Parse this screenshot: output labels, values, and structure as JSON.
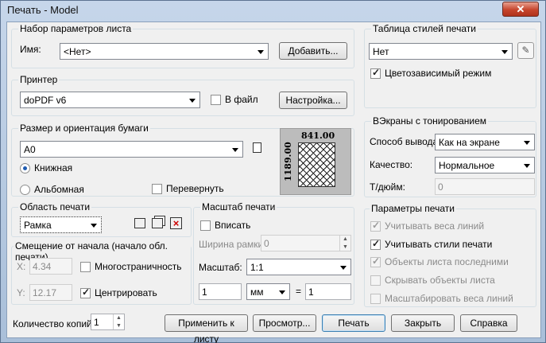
{
  "window": {
    "title": "Печать - Model",
    "close": "✕"
  },
  "page_setup": {
    "legend": "Набор параметров листа",
    "name_label": "Имя:",
    "name_value": "<Нет>",
    "add_button": "Добавить..."
  },
  "printer": {
    "legend": "Принтер",
    "name_value": "doPDF v6",
    "to_file_label": "В файл",
    "to_file_checked": false,
    "props_button": "Настройка..."
  },
  "paper": {
    "legend": "Размер и ориентация бумаги",
    "size_value": "A0",
    "portrait_label": "Книжная",
    "landscape_label": "Альбомная",
    "orientation": "portrait",
    "upside_down_label": "Перевернуть",
    "upside_down_checked": false,
    "preview_width": "841.00",
    "preview_height": "1189.00"
  },
  "plot_area": {
    "legend": "Область печати",
    "what_value": "Рамка"
  },
  "offset": {
    "legend": "Смещение от начала (начало обл. печати)",
    "x_label": "X:",
    "x_value": "4.34",
    "y_label": "Y:",
    "y_value": "12.17",
    "multi_label": "Многостраничность",
    "multi_checked": false,
    "center_label": "Центрировать",
    "center_checked": true
  },
  "scale": {
    "legend": "Масштаб печати",
    "fit_label": "Вписать",
    "fit_checked": false,
    "border_label": "Ширина рамки:",
    "border_value": "0",
    "scale_label": "Масштаб:",
    "scale_value": "1:1",
    "paper_units": "1",
    "unit_value": "мм",
    "eq": "=",
    "drawing_units": "1"
  },
  "style_table": {
    "legend": "Таблица стилей печати",
    "value": "Нет",
    "color_dep_label": "Цветозависимый режим",
    "color_dep_checked": true
  },
  "shaded": {
    "legend": "ВЭкраны с тонированием",
    "mode_label": "Способ вывода:",
    "mode_value": "Как на экране",
    "quality_label": "Качество:",
    "quality_value": "Нормальное",
    "dpi_label": "Т/дюйм:",
    "dpi_value": "0"
  },
  "options": {
    "legend": "Параметры печати",
    "items": [
      {
        "label": "Учитывать веса линий",
        "checked": true,
        "enabled": false
      },
      {
        "label": "Учитывать стили печати",
        "checked": true,
        "enabled": true
      },
      {
        "label": "Объекты листа последними",
        "checked": true,
        "enabled": false
      },
      {
        "label": "Скрывать объекты листа",
        "checked": false,
        "enabled": false
      },
      {
        "label": "Масштабировать веса линий",
        "checked": false,
        "enabled": false
      }
    ]
  },
  "copies": {
    "label": "Количество копий:",
    "value": "1"
  },
  "buttons": {
    "apply": "Применить к листу",
    "preview": "Просмотр...",
    "print": "Печать",
    "close": "Закрыть",
    "help": "Справка"
  },
  "colors": {
    "title_gradient_top": "#c6d6ea",
    "close_red": "#c6452c",
    "dialog_bg": "#f0f0f0"
  }
}
